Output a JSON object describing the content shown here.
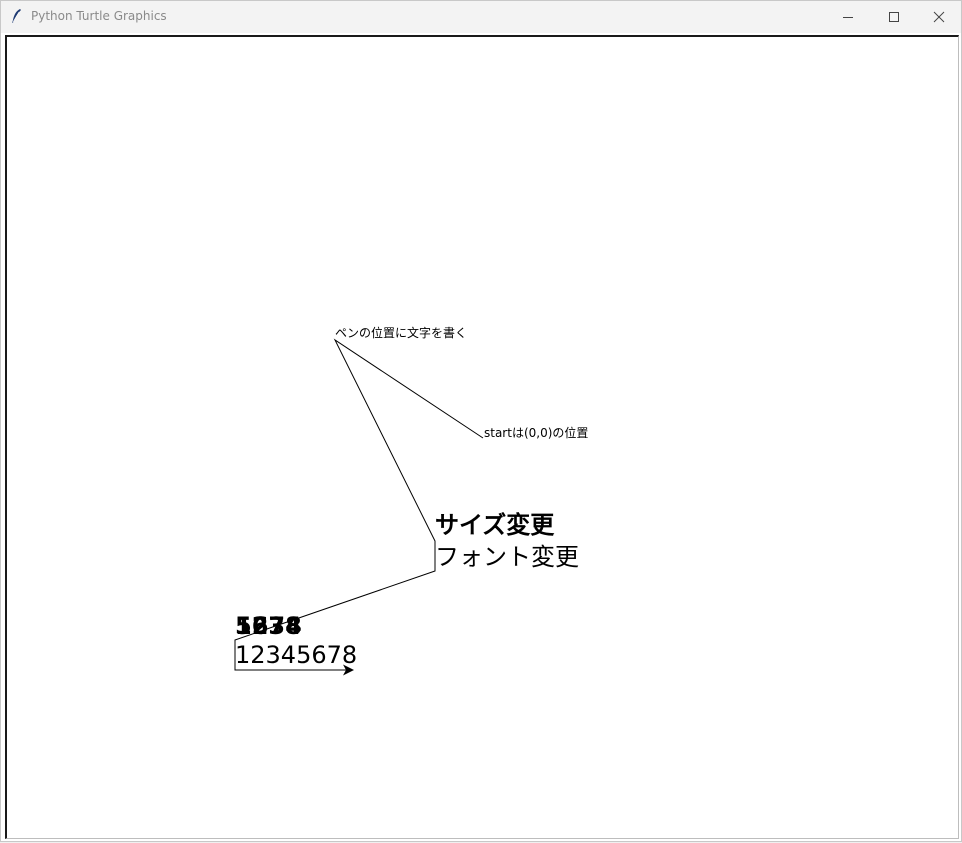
{
  "window": {
    "title": "Python Turtle Graphics",
    "controls": {
      "minimize_icon": "minimize-icon",
      "maximize_icon": "maximize-icon",
      "close_icon": "close-icon"
    }
  },
  "canvas": {
    "labels": {
      "pen_position": "ペンの位置に文字を書く",
      "start": "startは(0,0)の位置",
      "size_change": "サイズ変更",
      "font_change": "フォント変更",
      "overlap_1": "1234",
      "overlap_2": "5678",
      "numbers": "12345678"
    },
    "colors": {
      "pen": "#000000",
      "background": "#ffffff"
    },
    "cursor_icon": "turtle-arrow-icon"
  }
}
